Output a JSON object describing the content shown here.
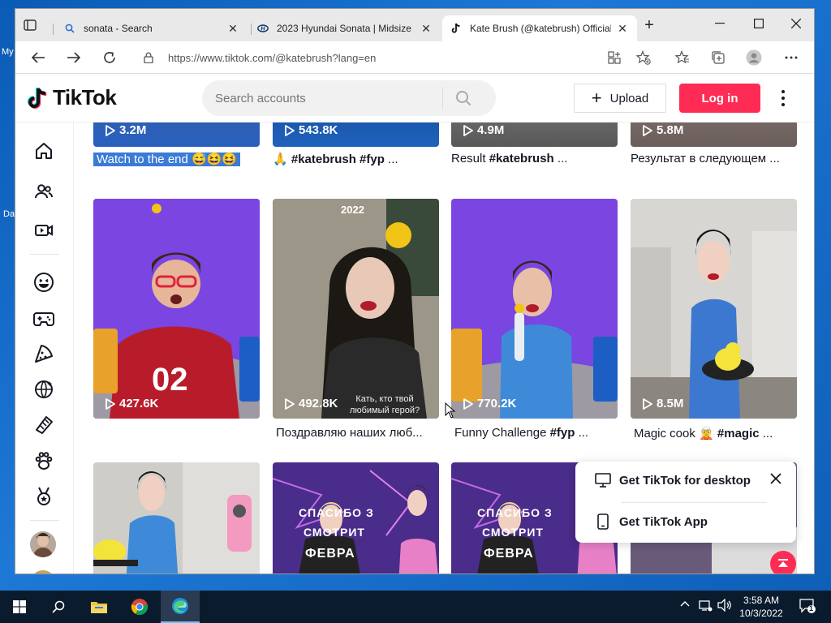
{
  "desktop": {
    "frag1": "My",
    "frag2": "Da"
  },
  "browser": {
    "tabs": [
      {
        "title": "sonata - Search",
        "icon": "search-icon"
      },
      {
        "title": "2023 Hyundai Sonata | Midsize S",
        "icon": "hyundai-logo-icon"
      },
      {
        "title": "Kate Brush (@katebrush) Official",
        "icon": "tiktok-icon"
      }
    ],
    "url": "https://www.tiktok.com/@katebrush?lang=en"
  },
  "tiktok": {
    "logo_text": "TikTok",
    "search_placeholder": "Search accounts",
    "upload_label": "Upload",
    "login_label": "Log in",
    "top_row": [
      {
        "views": "3.2M",
        "caption": "Watch to the end 😅😆😆",
        "selected": true
      },
      {
        "views": "543.8K",
        "caption_prefix": "🙏 ",
        "caption_tag": "#katebrush #fyp",
        "caption_suffix": " ..."
      },
      {
        "views": "4.9M",
        "caption_prefix": "Result ",
        "caption_tag": "#katebrush",
        "caption_suffix": " ..."
      },
      {
        "views": "5.8M",
        "caption": "Результат в следующем ..."
      }
    ],
    "middle_row": [
      {
        "views": "427.6K",
        "caption": ""
      },
      {
        "views": "492.8K",
        "caption": "Поздравляю наших люб...",
        "overlay_year": "2022",
        "overlay_sub": "Кать, кто твой любимый герой?"
      },
      {
        "views": "770.2K",
        "caption_prefix": "Funny Challenge ",
        "caption_tag": "#fyp",
        "caption_suffix": " ..."
      },
      {
        "views": "8.5M",
        "caption_prefix": "Magic cook 🧝 ",
        "caption_tag": "#magic",
        "caption_suffix": " ..."
      }
    ],
    "bottom_overlay_text": "СПАСИБО З",
    "bottom_overlay_text2": "СМОТРИТ",
    "bottom_overlay_text3": "ФЕВРА",
    "popup": {
      "desktop_label": "Get TikTok for desktop",
      "app_label": "Get TikTok App"
    }
  },
  "taskbar": {
    "time": "3:58 AM",
    "date": "10/3/2022",
    "notification_count": "1"
  },
  "colors": {
    "accent": "#fe2c55",
    "selection": "#3a7bd5"
  }
}
